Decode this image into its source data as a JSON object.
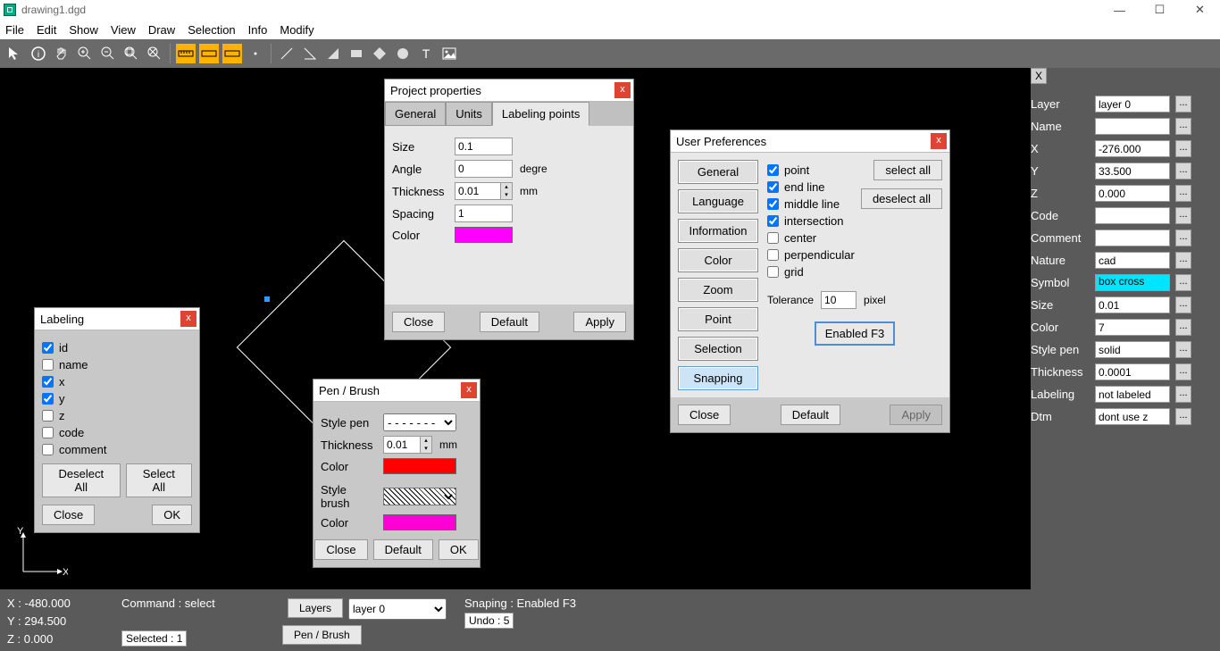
{
  "titlebar": {
    "title": "drawing1.dgd"
  },
  "menu": [
    "File",
    "Edit",
    "Show",
    "View",
    "Draw",
    "Selection",
    "Info",
    "Modify"
  ],
  "rpanel": {
    "layer": "layer 0",
    "name": "",
    "x": "-276.000",
    "y": "33.500",
    "z": "0.000",
    "code": "",
    "comment": "",
    "nature": "cad",
    "symbol": "box cross",
    "size": "0.01",
    "color": "7",
    "stylepen": "solid",
    "thickness": "0.0001",
    "labeling": "not labeled",
    "dtm": "dont use z",
    "lbl": {
      "layer": "Layer",
      "name": "Name",
      "x": "X",
      "y": "Y",
      "z": "Z",
      "code": "Code",
      "comment": "Comment",
      "nature": "Nature",
      "symbol": "Symbol",
      "size": "Size",
      "color": "Color",
      "stylepen": "Style pen",
      "thickness": "Thickness",
      "labeling": "Labeling",
      "dtm": "Dtm"
    }
  },
  "status": {
    "x": "X : -480.000",
    "y": "Y : 294.500",
    "z": "Z : 0.000",
    "command": "Command : select",
    "selected": "Selected : 1",
    "layers_btn": "Layers",
    "layer_sel": "layer 0",
    "penbrush_btn": "Pen / Brush",
    "snaping": "Snaping : Enabled  F3",
    "undo": "Undo : 5"
  },
  "labeling_dlg": {
    "title": "Labeling",
    "items": [
      {
        "label": "id",
        "checked": true
      },
      {
        "label": "name",
        "checked": false
      },
      {
        "label": "x",
        "checked": true
      },
      {
        "label": "y",
        "checked": true
      },
      {
        "label": "z",
        "checked": false
      },
      {
        "label": "code",
        "checked": false
      },
      {
        "label": "comment",
        "checked": false
      }
    ],
    "deselect": "Deselect All",
    "select": "Select All",
    "close": "Close",
    "ok": "OK"
  },
  "penbrush_dlg": {
    "title": "Pen / Brush",
    "stylepen_lbl": "Style pen",
    "thickness_lbl": "Thickness",
    "thickness": "0.01",
    "mm": "mm",
    "color_lbl": "Color",
    "pen_color": "#ff0000",
    "stylebrush_lbl": "Style brush",
    "brush_color": "#ff00d4",
    "close": "Close",
    "default": "Default",
    "ok": "OK"
  },
  "project_dlg": {
    "title": "Project properties",
    "tabs": [
      "General",
      "Units",
      "Labeling points"
    ],
    "size_lbl": "Size",
    "size": "0.1",
    "angle_lbl": "Angle",
    "angle": "0",
    "degree": "degre",
    "thickness_lbl": "Thickness",
    "thickness": "0.01",
    "mm": "mm",
    "spacing_lbl": "Spacing",
    "spacing": "1",
    "color_lbl": "Color",
    "color": "#ff00ff",
    "close": "Close",
    "default": "Default",
    "apply": "Apply"
  },
  "userprefs_dlg": {
    "title": "User Preferences",
    "side": [
      "General",
      "Language",
      "Information",
      "Color",
      "Zoom",
      "Point",
      "Selection",
      "Snapping"
    ],
    "checks": [
      {
        "label": "point",
        "checked": true
      },
      {
        "label": "end line",
        "checked": true
      },
      {
        "label": "middle line",
        "checked": true
      },
      {
        "label": "intersection",
        "checked": true
      },
      {
        "label": "center",
        "checked": false
      },
      {
        "label": "perpendicular",
        "checked": false
      },
      {
        "label": "grid",
        "checked": false
      }
    ],
    "selectall": "select all",
    "deselectall": "deselect all",
    "tolerance_lbl": "Tolerance",
    "tolerance": "10",
    "pixel": "pixel",
    "enabled": "Enabled  F3",
    "close": "Close",
    "default": "Default",
    "apply": "Apply"
  }
}
